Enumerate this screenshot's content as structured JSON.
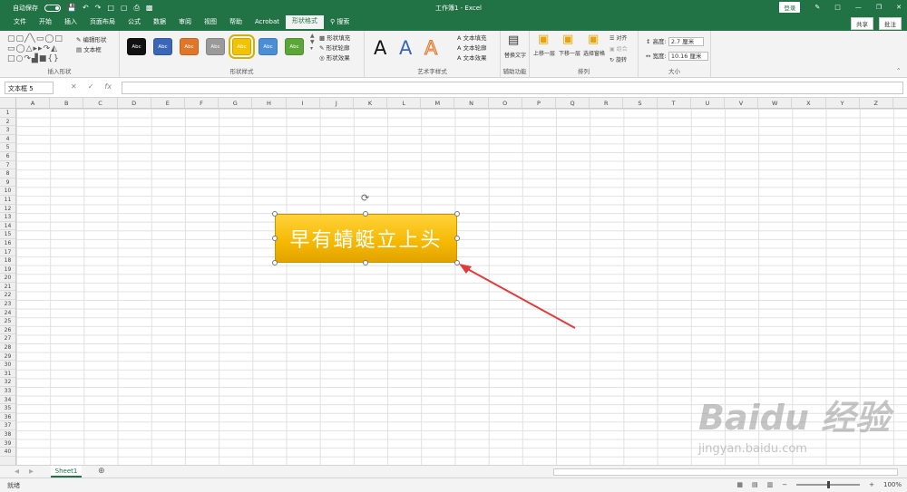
{
  "titlebar": {
    "autosave_label": "自动保存",
    "title": "工作簿1 - Excel",
    "login_label": "登录"
  },
  "tabs": [
    "文件",
    "开始",
    "插入",
    "页面布局",
    "公式",
    "数据",
    "审阅",
    "视图",
    "帮助",
    "Acrobat",
    "形状格式",
    "搜索"
  ],
  "tabs_right": {
    "share": "共享",
    "comment": "批注"
  },
  "ribbon": {
    "insert_shape": {
      "label": "插入形状",
      "edit_shape": "编辑形状",
      "textbox": "文本框"
    },
    "shape_styles": {
      "label": "形状样式",
      "fill": "形状填充",
      "outline": "形状轮廓",
      "effect": "形状效果",
      "items": [
        {
          "text": "Abc",
          "color": "#111111"
        },
        {
          "text": "Abc",
          "color": "#3a66b8"
        },
        {
          "text": "Abc",
          "color": "#e0762a"
        },
        {
          "text": "Abc",
          "color": "#9a9a9a"
        },
        {
          "text": "Abc",
          "color": "#f2c400"
        },
        {
          "text": "Abc",
          "color": "#4a8fd6"
        },
        {
          "text": "Abc",
          "color": "#5aa637"
        }
      ]
    },
    "wordart": {
      "label": "艺术字样式",
      "letter": "A",
      "text_fill": "文本填充",
      "text_outline": "文本轮廓",
      "text_effect": "文本效果"
    },
    "accessibility": {
      "label": "辅助功能",
      "alt_text": "替换文字"
    },
    "arrange": {
      "label": "排列",
      "forward": "上移一层",
      "backward": "下移一层",
      "selection_pane": "选择窗格",
      "align": "对齐",
      "group": "组合",
      "rotate": "旋转"
    },
    "size": {
      "label": "大小",
      "height_label": "高度:",
      "height_value": "2.7 厘米",
      "width_label": "宽度:",
      "width_value": "10.16 厘米"
    }
  },
  "formula": {
    "namebox": "文本框 5",
    "fx": "fx"
  },
  "grid": {
    "columns": [
      "A",
      "B",
      "C",
      "D",
      "E",
      "F",
      "G",
      "H",
      "I",
      "J",
      "K",
      "L",
      "M",
      "N",
      "O",
      "P",
      "Q",
      "R",
      "S",
      "T",
      "U",
      "V",
      "W",
      "X",
      "Y",
      "Z"
    ],
    "rows": [
      "1",
      "2",
      "3",
      "4",
      "5",
      "6",
      "7",
      "8",
      "9",
      "10",
      "11",
      "12",
      "13",
      "14",
      "15",
      "16",
      "17",
      "18",
      "19",
      "20",
      "21",
      "22",
      "23",
      "24",
      "25",
      "26",
      "27",
      "28",
      "29",
      "30",
      "31",
      "32",
      "33",
      "34",
      "35",
      "36",
      "37",
      "38",
      "39",
      "40"
    ]
  },
  "shape": {
    "text": "早有蜻蜓立上头"
  },
  "sheets": {
    "active": "Sheet1"
  },
  "status": {
    "ready": "就绪",
    "zoom": "100%"
  },
  "watermark": {
    "brand": "Baidu 经验",
    "url": "jingyan.baidu.com"
  }
}
